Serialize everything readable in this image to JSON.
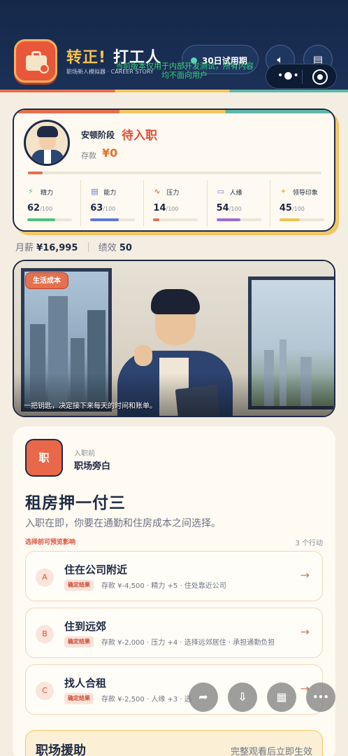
{
  "header": {
    "title_part1": "转正!",
    "title_part2": "打工人",
    "subtitle": "职场新人模拟器 · CAREER STORY",
    "trial_label": "30日试用期",
    "notice": "当前版本仅用于内部开发测试，所有内容均不面向用户",
    "sound_icon": "speaker-icon",
    "log_icon": "document-icon",
    "capsule_more": "•●•",
    "capsule_close_icon": "target-icon"
  },
  "profile": {
    "stage_label": "安顿阶段",
    "stage_value": "待入职",
    "savings_label": "存款",
    "savings_value": "¥0",
    "progress": 0.05,
    "stats": [
      {
        "name": "精力",
        "value": "62",
        "max": "/100",
        "color": "#48c27a",
        "fraction": 0.62,
        "icon": "bolt-icon",
        "glyph": "⚡"
      },
      {
        "name": "能力",
        "value": "63",
        "max": "/100",
        "color": "#5b77d9",
        "fraction": 0.63,
        "icon": "briefcase-icon",
        "glyph": "▤"
      },
      {
        "name": "压力",
        "value": "14",
        "max": "/100",
        "color": "#e3714e",
        "fraction": 0.14,
        "icon": "pulse-icon",
        "glyph": "∿"
      },
      {
        "name": "人缘",
        "value": "54",
        "max": "/100",
        "color": "#9a6bd8",
        "fraction": 0.54,
        "icon": "chat-icon",
        "glyph": "▭"
      },
      {
        "name": "领导印象",
        "value": "45",
        "max": "/100",
        "color": "#f0c14e",
        "fraction": 0.45,
        "icon": "star-icon",
        "glyph": "✦"
      }
    ]
  },
  "summary": {
    "salary_label": "月薪",
    "salary_value": "¥16,995",
    "performance_label": "绩效",
    "performance_value": "50"
  },
  "scene": {
    "tag": "生活成本",
    "caption": "一把钥匙，决定接下来每天的时间和账单。"
  },
  "event": {
    "badge": "职",
    "pre_label": "入职前",
    "source": "职场旁白",
    "title": "租房押一付三",
    "description": "入职在即，你要在通勤和住房成本之间选择。",
    "hint": "选择前可预览影响",
    "count": "3 个行动",
    "options": [
      {
        "letter": "A",
        "title": "住在公司附近",
        "tag": "确定结果",
        "effects": "存款 ¥-4,500 · 精力 +5 · 住处靠近公司"
      },
      {
        "letter": "B",
        "title": "住到远郊",
        "tag": "确定结果",
        "effects": "存款 ¥-2,000 · 压力 +4 · 选择远郊居住 · 承担通勤负担"
      },
      {
        "letter": "C",
        "title": "找人合租",
        "tag": "确定结果",
        "effects": "存款 ¥-2,500 · 人缘 +3 · 选"
      }
    ]
  },
  "aid": {
    "title": "职场援助",
    "hint": "完整观看后立即生效"
  },
  "fabs": [
    {
      "icon": "share-icon",
      "glyph": "➦"
    },
    {
      "icon": "download-icon",
      "glyph": "⇩"
    },
    {
      "icon": "grid-icon",
      "glyph": "▦"
    },
    {
      "icon": "more-icon",
      "glyph": "•••"
    }
  ]
}
